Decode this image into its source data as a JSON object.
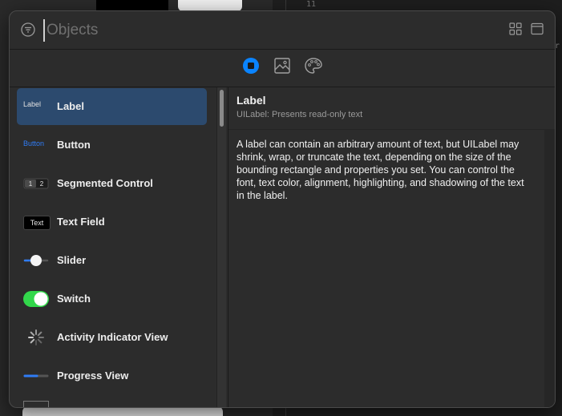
{
  "background": {
    "line_number": "11",
    "cut_text": "er"
  },
  "search": {
    "placeholder": "Objects"
  },
  "tabs": [
    {
      "name": "objects",
      "active": true
    },
    {
      "name": "media",
      "active": false
    },
    {
      "name": "colors",
      "active": false
    }
  ],
  "library": {
    "items": [
      {
        "label": "Label",
        "thumb_text": "Label"
      },
      {
        "label": "Button",
        "thumb_text": "Button"
      },
      {
        "label": "Segmented Control",
        "thumb_text": [
          "1",
          "2"
        ]
      },
      {
        "label": "Text Field",
        "thumb_text": "Text"
      },
      {
        "label": "Slider"
      },
      {
        "label": "Switch"
      },
      {
        "label": "Activity Indicator View"
      },
      {
        "label": "Progress View"
      }
    ]
  },
  "detail": {
    "title": "Label",
    "subtitle": "UILabel: Presents read-only text",
    "description": "A label can contain an arbitrary amount of text, but UILabel may shrink, wrap, or truncate the text, depending on the size of the bounding rectangle and properties you set. You can control the font, text color, alignment, highlighting, and shadowing of the text in the label."
  },
  "colors": {
    "accent": "#0a84ff",
    "selection": "#2c4a6e",
    "switch_on": "#32d74b"
  }
}
